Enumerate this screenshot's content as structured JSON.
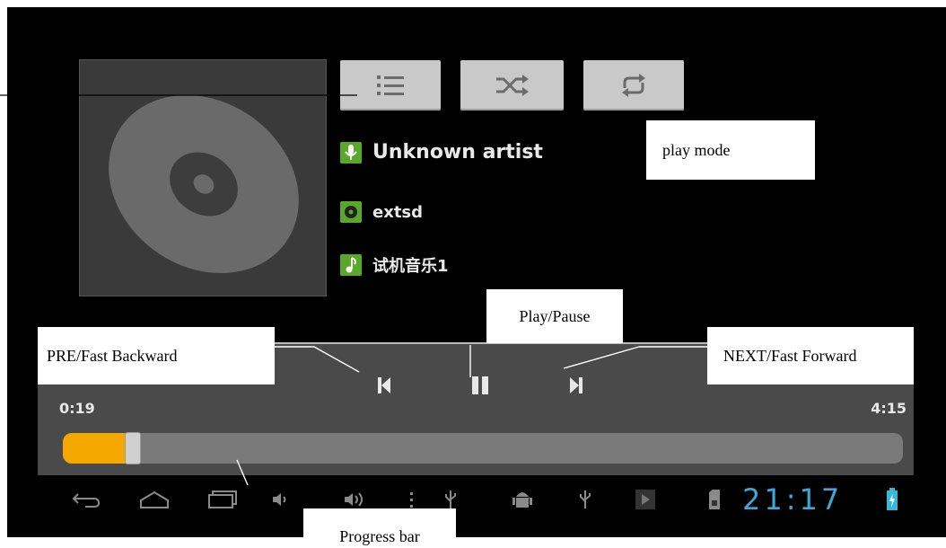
{
  "album_art": {
    "icon": "disc-icon"
  },
  "mode_buttons": [
    {
      "name": "playlist-button",
      "icon": "list-icon"
    },
    {
      "name": "shuffle-button",
      "icon": "shuffle-icon"
    },
    {
      "name": "repeat-button",
      "icon": "repeat-icon"
    }
  ],
  "track_info": {
    "artist": "Unknown artist",
    "album": "extsd",
    "title": "试机音乐1"
  },
  "player": {
    "elapsed": "0:19",
    "duration": "4:15",
    "progress_fraction": 0.084,
    "accent_color": "#f5a800"
  },
  "status_bar": {
    "clock": "21:17",
    "clock_color": "#3aa8d8",
    "battery_color": "#36b8d8"
  },
  "annotations": {
    "play_mode": "play mode",
    "play_pause": "Play/Pause",
    "pre": "PRE/Fast Backward",
    "next": "NEXT/Fast Forward",
    "progress": "Progress bar"
  }
}
